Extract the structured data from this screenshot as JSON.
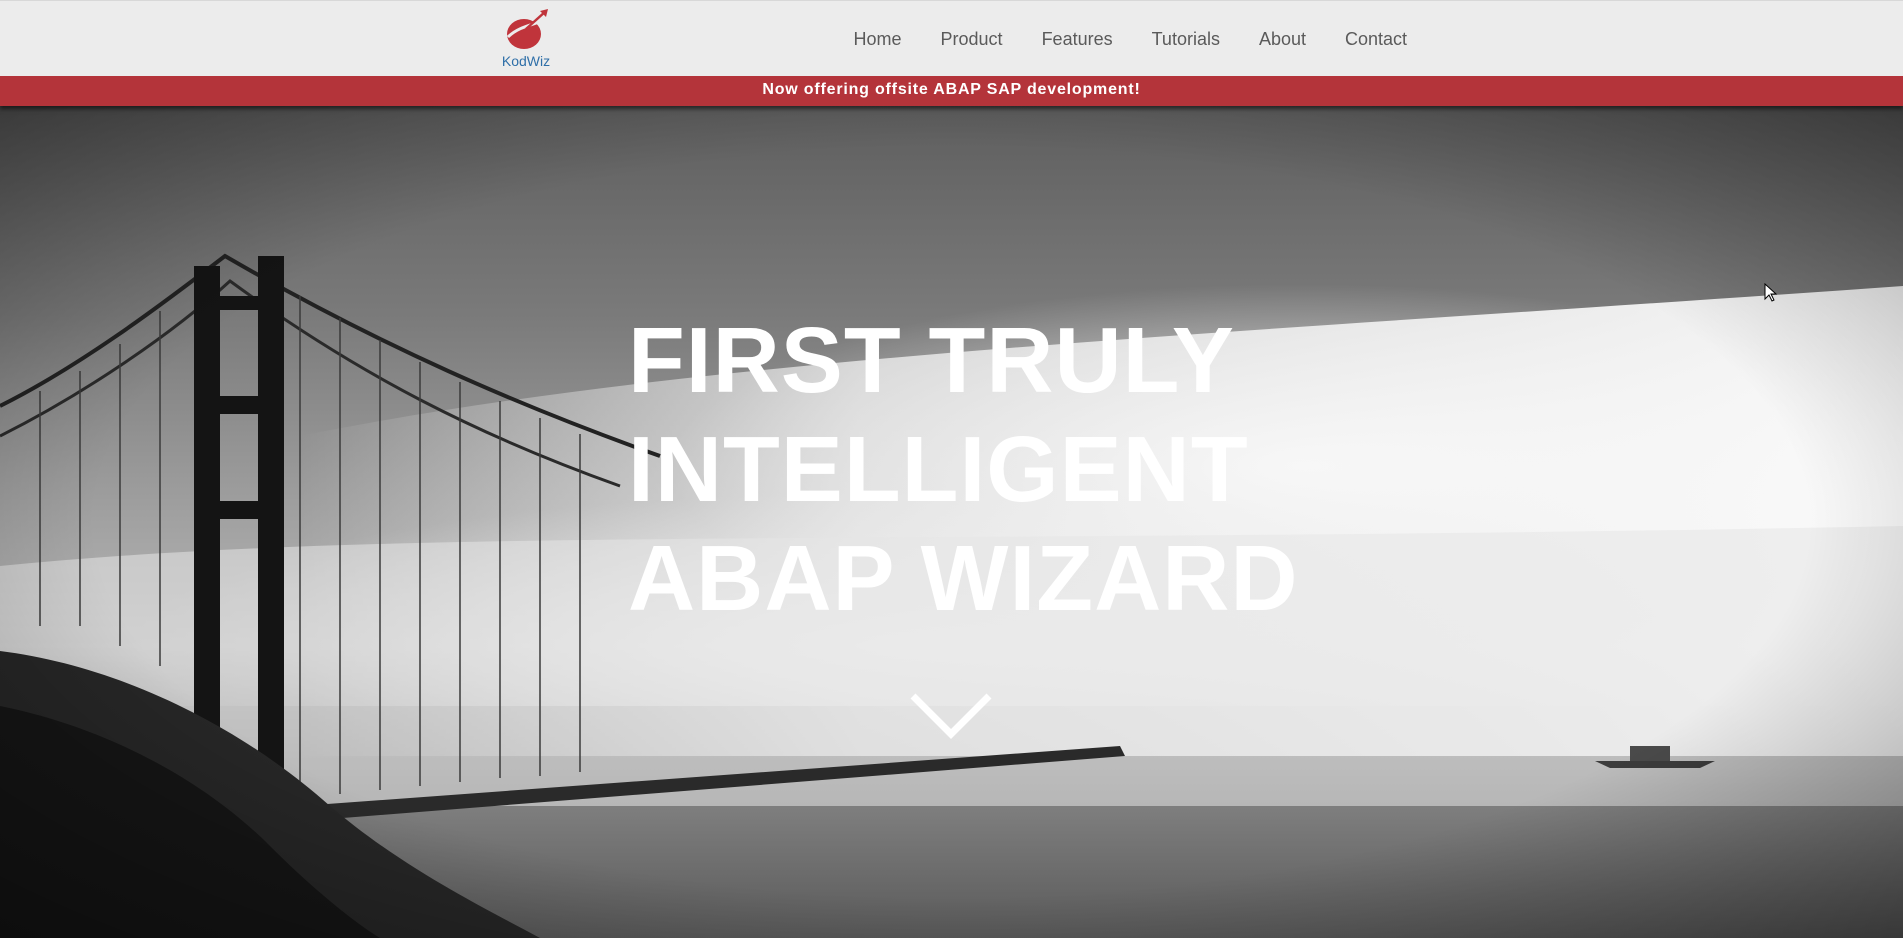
{
  "brand": {
    "name": "KodWiz",
    "logo_icon": "rocket-planet-icon",
    "logo_color": "#c0343b",
    "name_color": "#2f6fa8"
  },
  "nav": {
    "items": [
      {
        "label": "Home"
      },
      {
        "label": "Product"
      },
      {
        "label": "Features"
      },
      {
        "label": "Tutorials"
      },
      {
        "label": "About"
      },
      {
        "label": "Contact"
      }
    ]
  },
  "announcement": {
    "text": "Now offering offsite ABAP SAP development!",
    "background": "#b4343a"
  },
  "hero": {
    "headline_lines": [
      "FIRST TRULY",
      "INTELLIGENT",
      "ABAP WIZARD"
    ],
    "background_image": "foggy suspension bridge (grayscale)",
    "scroll_icon": "chevron-down-icon"
  }
}
